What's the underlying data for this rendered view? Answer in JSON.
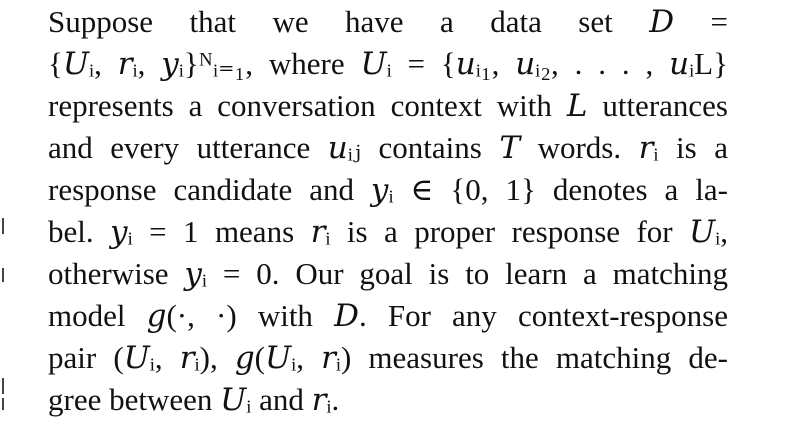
{
  "paragraph": {
    "lines": [
      "Suppose that we have a data set 𝐷 =",
      "{𝑈ᵢ, 𝑟ᵢ, 𝑦ᵢ}ᴺᵢ₌₁, where 𝑈ᵢ = {𝑢ᵢ₁, 𝑢ᵢ₂, . . . , 𝑢ᵢL}",
      "represents a conversation context with 𝐿 utterances",
      "and every utterance 𝑢ᵢⱼ contains 𝑇 words. 𝑟ᵢ is a",
      "response candidate and 𝑦ᵢ ∈ {0, 1} denotes a la-",
      "bel. 𝑦ᵢ = 1 means 𝑟ᵢ is a proper response for 𝑈ᵢ,",
      "otherwise 𝑦ᵢ = 0. Our goal is to learn a matching",
      "model 𝑔(·, ·) with 𝐷. For any context-response",
      "pair (𝑈ᵢ, 𝑟ᵢ), 𝑔(𝑈ᵢ, 𝑟ᵢ) measures the matching de-",
      "gree between 𝑈ᵢ and 𝑟ᵢ."
    ]
  }
}
